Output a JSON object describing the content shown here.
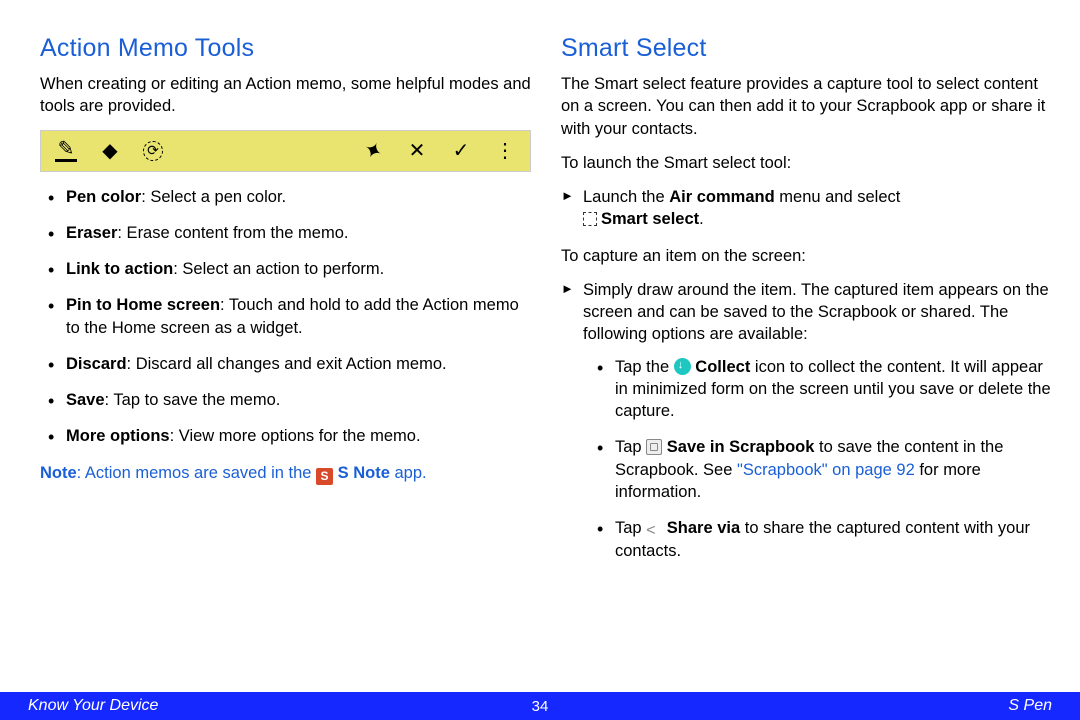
{
  "left": {
    "heading": "Action Memo Tools",
    "intro": "When creating or editing an Action memo, some helpful modes and tools are provided.",
    "items": [
      {
        "term": "Pen color",
        "desc": ": Select a pen color."
      },
      {
        "term": "Eraser",
        "desc": ": Erase content from the memo."
      },
      {
        "term": "Link to action",
        "desc": ": Select an action to perform."
      },
      {
        "term": "Pin to Home screen",
        "desc": ": Touch and hold to add the Action memo to the Home screen as a widget."
      },
      {
        "term": "Discard",
        "desc": ": Discard all changes and exit Action memo."
      },
      {
        "term": "Save",
        "desc": ": Tap to save the memo."
      },
      {
        "term": "More options",
        "desc": ": View more options for the memo."
      }
    ],
    "note_prefix": "Note",
    "note_mid": ": Action memos are saved in the ",
    "note_icon_letter": "S",
    "note_app": " S Note",
    "note_suffix": " app."
  },
  "right": {
    "heading": "Smart Select",
    "intro": "The Smart select feature provides a capture tool to select content on a screen. You can then add it to your Scrapbook app or share it with your contacts.",
    "launch_label": "To launch the Smart select tool:",
    "launch_step_a": "Launch the ",
    "launch_step_b": "Air command",
    "launch_step_c": " menu and select ",
    "launch_step_d": "Smart select",
    "launch_step_e": ".",
    "capture_label": "To capture an item on the screen:",
    "capture_step": "Simply draw around the item. The captured item appears on the screen and can be saved to the Scrapbook or shared. The following options are available:",
    "opt1_a": "Tap the ",
    "opt1_b": " Collect",
    "opt1_c": " icon to collect the content. It will appear in minimized form on the screen until you save or delete the capture.",
    "opt2_a": "Tap ",
    "opt2_b": " Save in Scrapbook",
    "opt2_c": " to save the content in the Scrapbook. See ",
    "opt2_link": "\"Scrapbook\" on page 92",
    "opt2_d": " for more information.",
    "opt3_a": "Tap ",
    "opt3_b": " Share via",
    "opt3_c": " to share the captured content with your contacts."
  },
  "footer": {
    "left": "Know Your Device",
    "center": "34",
    "right": "S Pen"
  },
  "toolbar_icons": {
    "pencil": "✎",
    "eraser": "◆",
    "link": "⟳",
    "pin": "✦",
    "discard": "✕",
    "save": "✓",
    "more": "⋮"
  }
}
